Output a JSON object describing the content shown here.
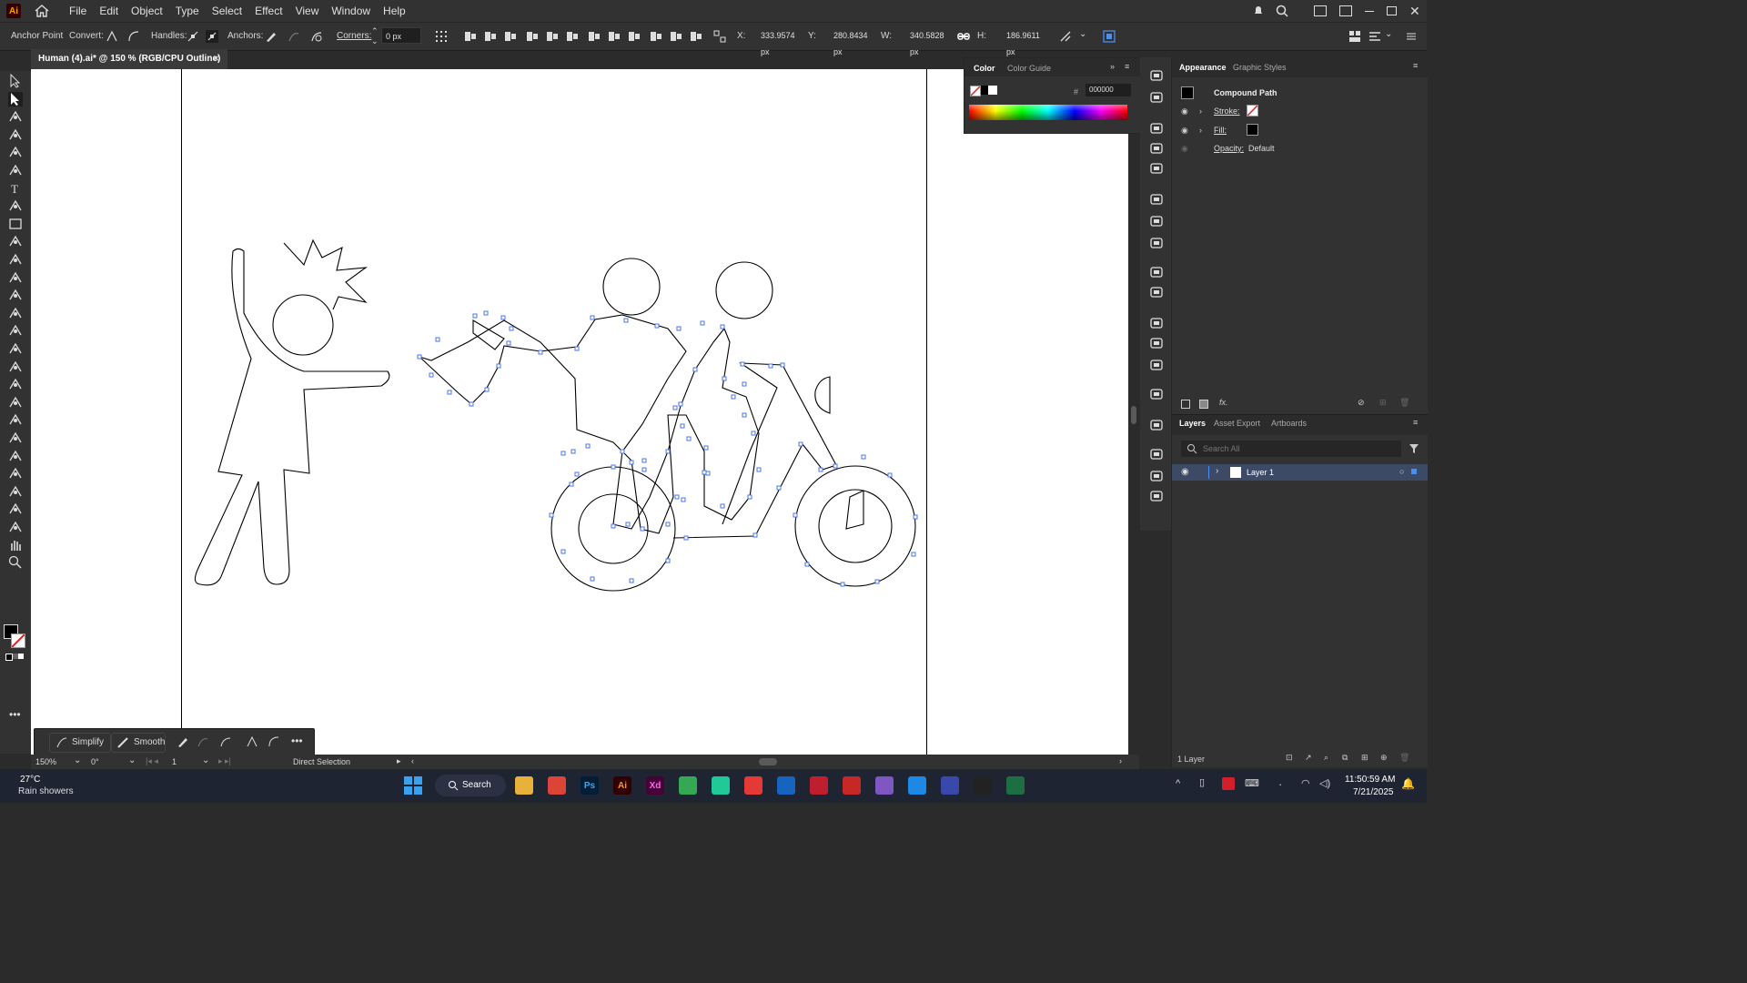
{
  "app": {
    "logo": "Ai"
  },
  "menu": [
    "File",
    "Edit",
    "Object",
    "Type",
    "Select",
    "Effect",
    "View",
    "Window",
    "Help"
  ],
  "control": {
    "anchor_point": "Anchor Point",
    "convert": "Convert:",
    "handles": "Handles:",
    "anchors": "Anchors:",
    "corners": "Corners:",
    "corners_value": "0 px",
    "x_label": "X:",
    "x_value": "333.9574 px",
    "y_label": "Y:",
    "y_value": "280.8434 px",
    "w_label": "W:",
    "w_value": "340.5828 px",
    "h_label": "H:",
    "h_value": "186.9611 px"
  },
  "document": {
    "tab_title": "Human (4).ai* @ 150 % (RGB/CPU Outline)",
    "close": "×"
  },
  "color_panel": {
    "tab_active": "Color",
    "tab_other": "Color Guide",
    "hex_prefix": "#",
    "hex_value": "000000"
  },
  "appearance": {
    "tab_active": "Appearance",
    "tab_other": "Graphic Styles",
    "object": "Compound Path",
    "stroke_label": "Stroke:",
    "fill_label": "Fill:",
    "opacity_label": "Opacity:",
    "opacity_value": "Default",
    "fx": "fx."
  },
  "layers": {
    "tabs": [
      "Layers",
      "Asset Export",
      "Artboards"
    ],
    "search_placeholder": "Search All",
    "layer_name": "Layer 1",
    "footer": "1 Layer"
  },
  "status": {
    "zoom": "150%",
    "rotation": "0°",
    "artboard": "1",
    "tool": "Direct Selection"
  },
  "floating_toolbar": {
    "simplify": "Simplify",
    "smooth": "Smooth"
  },
  "weather": {
    "temp": "27°C",
    "desc": "Rain showers"
  },
  "taskbar": {
    "search": "Search"
  },
  "clock": {
    "time": "11:50:59 AM",
    "date": "7/21/2025"
  },
  "colors": {
    "accent": "#3e7bd6",
    "selection": "#4a76e8",
    "panel": "#323232",
    "canvas": "#ffffff"
  }
}
